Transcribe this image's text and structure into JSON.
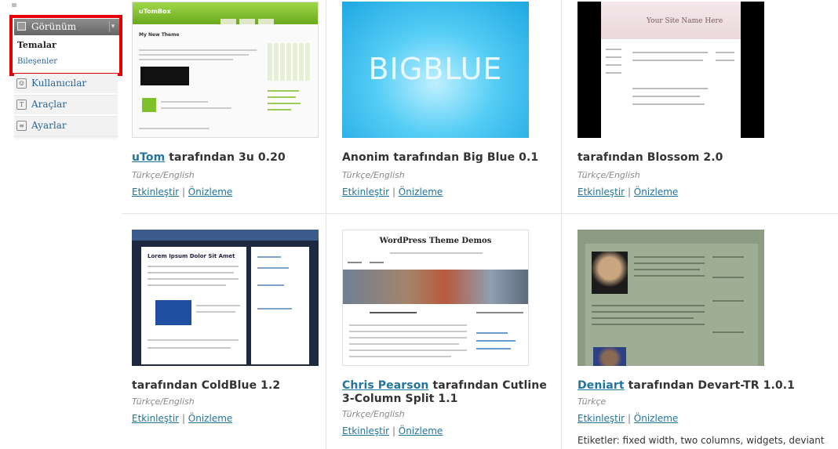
{
  "sidebar": {
    "appearance_label": "Görünüm",
    "submenu": {
      "themes": "Temalar",
      "widgets": "Bileşenler"
    },
    "items": [
      {
        "label": "Kullanıcılar",
        "icon": "users-icon"
      },
      {
        "label": "Araçlar",
        "icon": "tools-icon"
      },
      {
        "label": "Ayarlar",
        "icon": "settings-icon"
      }
    ]
  },
  "themes": [
    {
      "author_link": "uTom",
      "title": " tarafından 3u 0.20",
      "lang": "Türkçe/English",
      "activate": "Etkinleştir",
      "preview": "Önizleme",
      "thumb": {
        "logo": "uTomBox",
        "post": "My New Theme"
      }
    },
    {
      "author_prefix": "Anonim",
      "title": " tarafından Big Blue 0.1",
      "lang": "Türkçe/English",
      "activate": "Etkinleştir",
      "preview": "Önizleme",
      "thumb": {
        "text": "BIGBLUE"
      }
    },
    {
      "title": "tarafından Blossom 2.0",
      "lang": "Türkçe/English",
      "activate": "Etkinleştir",
      "preview": "Önizleme",
      "thumb": {
        "header": "Your Site Name Here"
      }
    },
    {
      "title": "tarafından ColdBlue 1.2",
      "lang": "Türkçe/English",
      "activate": "Etkinleştir",
      "preview": "Önizleme",
      "thumb": {
        "heading": "Lorem Ipsum Dolor Sit Amet"
      }
    },
    {
      "author_link": "Chris Pearson",
      "title": " tarafından Cutline 3-Column Split 1.1",
      "lang": "Türkçe/English",
      "activate": "Etkinleştir",
      "preview": "Önizleme",
      "thumb": {
        "heading": "WordPress Theme Demos"
      }
    },
    {
      "author_link": "Deniart",
      "title": " tarafından Devart-TR 1.0.1",
      "lang": "Türkçe",
      "activate": "Etkinleştir",
      "preview": "Önizleme",
      "tags": "Etiketler: fixed width, two columns, widgets, deviant"
    }
  ],
  "separator": " | ",
  "colors": {
    "link": "#21759b",
    "highlight_box": "#e60000",
    "menu_head": "#777777"
  }
}
